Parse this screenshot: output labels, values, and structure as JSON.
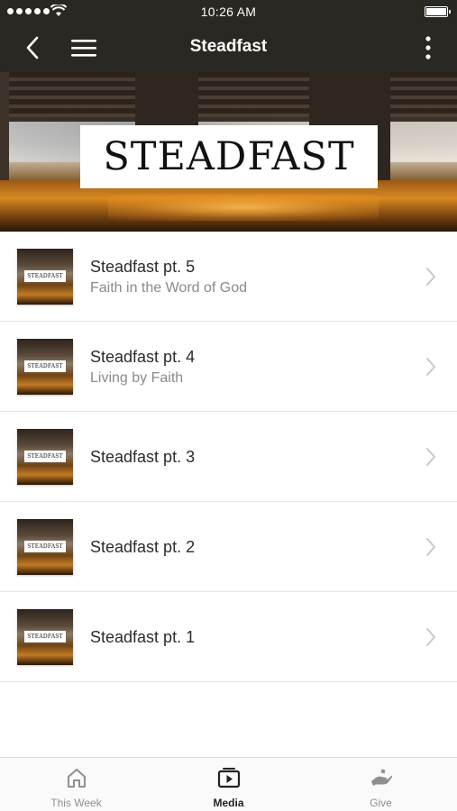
{
  "status_bar": {
    "time": "10:26 AM"
  },
  "nav": {
    "title": "Steadfast",
    "back_icon": "chevron-left-icon",
    "menu_icon": "hamburger-menu-icon",
    "more_icon": "vertical-dots-icon"
  },
  "hero": {
    "label": "STEADFAST"
  },
  "thumbnail_label": "STEADFAST",
  "items": [
    {
      "title": "Steadfast pt. 5",
      "subtitle": "Faith in the Word of God"
    },
    {
      "title": "Steadfast pt. 4",
      "subtitle": "Living by Faith"
    },
    {
      "title": "Steadfast pt. 3",
      "subtitle": ""
    },
    {
      "title": "Steadfast pt. 2",
      "subtitle": ""
    },
    {
      "title": "Steadfast pt. 1",
      "subtitle": ""
    }
  ],
  "tabs": [
    {
      "label": "This Week",
      "icon": "home-icon",
      "active": false
    },
    {
      "label": "Media",
      "icon": "media-play-icon",
      "active": true
    },
    {
      "label": "Give",
      "icon": "give-hand-icon",
      "active": false
    }
  ],
  "colors": {
    "header_bg": "#2a2823",
    "active_tab": "#222222",
    "inactive_tab": "#8f8f8f"
  }
}
